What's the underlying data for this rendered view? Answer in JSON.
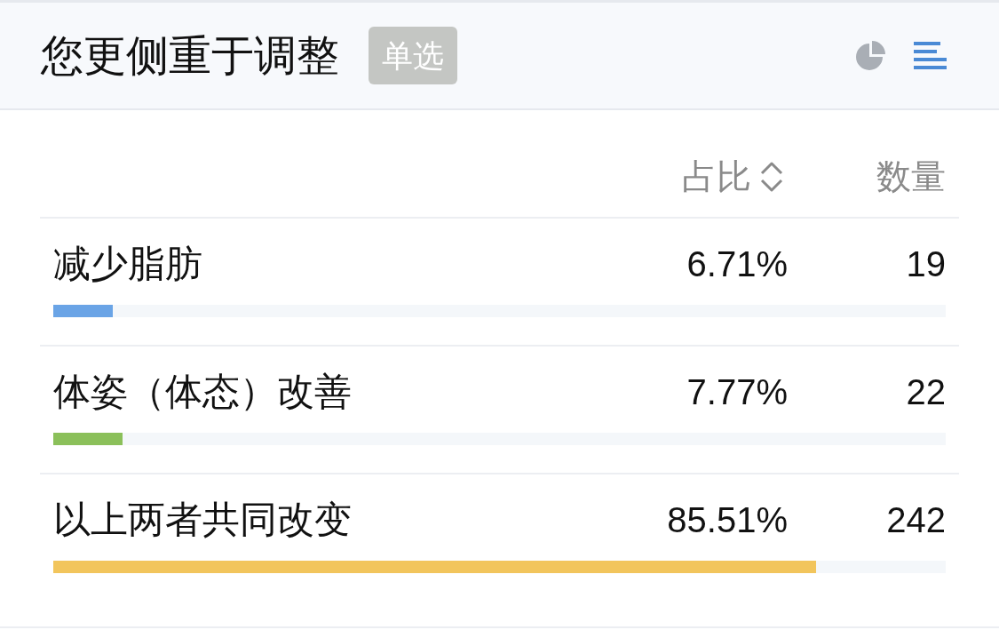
{
  "header": {
    "title": "您更侧重于调整",
    "badge": "单选",
    "view_toggles": [
      {
        "kind": "pie",
        "selected": false
      },
      {
        "kind": "bar",
        "selected": true
      }
    ]
  },
  "table": {
    "columns": [
      {
        "label": "占比",
        "sortable": true
      },
      {
        "label": "数量",
        "sortable": false
      }
    ],
    "rows": [
      {
        "label": "减少脂肪",
        "percent": "6.71%",
        "count": "19",
        "level": 0.0671,
        "color": "#6aa4e6"
      },
      {
        "label": "体姿（体态）改善",
        "percent": "7.77%",
        "count": "22",
        "level": 0.0777,
        "color": "#8bc05a"
      },
      {
        "label": "以上两者共同改变",
        "percent": "85.51%",
        "count": "242",
        "level": 0.8551,
        "color": "#f2c55c"
      }
    ]
  }
}
